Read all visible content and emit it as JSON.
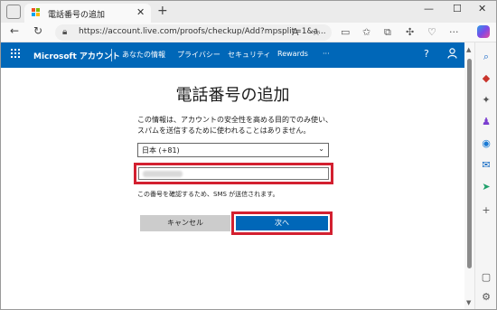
{
  "browser": {
    "tab_title": "電話番号の追加",
    "tab_close": "✕",
    "new_tab": "+",
    "url": "https://account.live.com/proofs/checkup/Add?mpsplit=1&a...",
    "window_controls": {
      "minimize": "—",
      "maximize": "☐",
      "close": "✕"
    }
  },
  "ms_header": {
    "brand": "Microsoft アカウント",
    "nav": [
      "あなたの情報",
      "プライバシー",
      "セキュリティ",
      "Rewards",
      "···"
    ],
    "help": "?",
    "profile_icon": "person-icon"
  },
  "form": {
    "title": "電話番号の追加",
    "description": "この情報は、アカウントの安全性を高める目的でのみ使い、スパムを送信するために使われることはありません。",
    "country_select": "日本 (+81)",
    "phone_value_obscured": true,
    "note": "この番号を確認するため、SMS が送信されます。",
    "cancel_label": "キャンセル",
    "next_label": "次へ"
  },
  "colors": {
    "ms_blue": "#0067b8",
    "highlight_red": "#d32030",
    "cancel_grey": "#cccccc"
  }
}
